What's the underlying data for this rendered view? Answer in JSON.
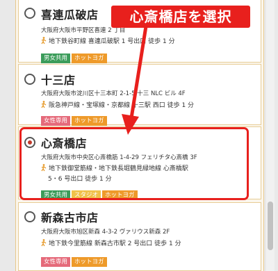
{
  "stores": [
    {
      "name": "喜連瓜破店",
      "address": "大阪府大阪市平野区喜連 2 丁目",
      "access_line1": "地下鉄谷町線 喜連瓜破駅 1 号出口 徒歩 1 分",
      "access_line2": "",
      "tags": [
        "男女共用",
        "ホットヨガ"
      ],
      "selected": false
    },
    {
      "name": "十三店",
      "address": "大阪府大阪市淀川区十三本町 2-1-5 十三 NLC ビル 4F",
      "access_line1": "阪急神戸線・宝塚線・京都線 十三駅 西口 徒歩 1 分",
      "access_line2": "",
      "tags": [
        "女性専用",
        "ホットヨガ"
      ],
      "selected": false
    },
    {
      "name": "心斎橋店",
      "address": "大阪府大阪市中央区心斎橋筋 1-4-29 フェリチタ心斎橋 3F",
      "access_line1": "地下鉄御堂筋線・地下鉄長堀鶴見緑地線 心斎橋駅",
      "access_line2": "5・6 号出口 徒歩 1 分",
      "tags": [
        "男女共用",
        "スタジオ",
        "ホットヨガ"
      ],
      "selected": true
    },
    {
      "name": "新森古市店",
      "address": "大阪府大阪市旭区新森 4-3-2 ヴァリウス新森 2F",
      "access_line1": "地下鉄今里筋線 新森古市駅 2 号出口 徒歩 1 分",
      "access_line2": "",
      "tags": [
        "女性専用",
        "ホットヨガ"
      ],
      "selected": false
    }
  ],
  "annotation": {
    "callout_text": "心斎橋店を選択"
  },
  "colors": {
    "annotation_red": "#e8201d",
    "tag_green": "#3b9c5a",
    "tag_orange": "#ee9a2a",
    "tag_pink": "#e56a7a",
    "tag_yellow": "#f0c24a",
    "panel_border": "#e8c98b"
  }
}
